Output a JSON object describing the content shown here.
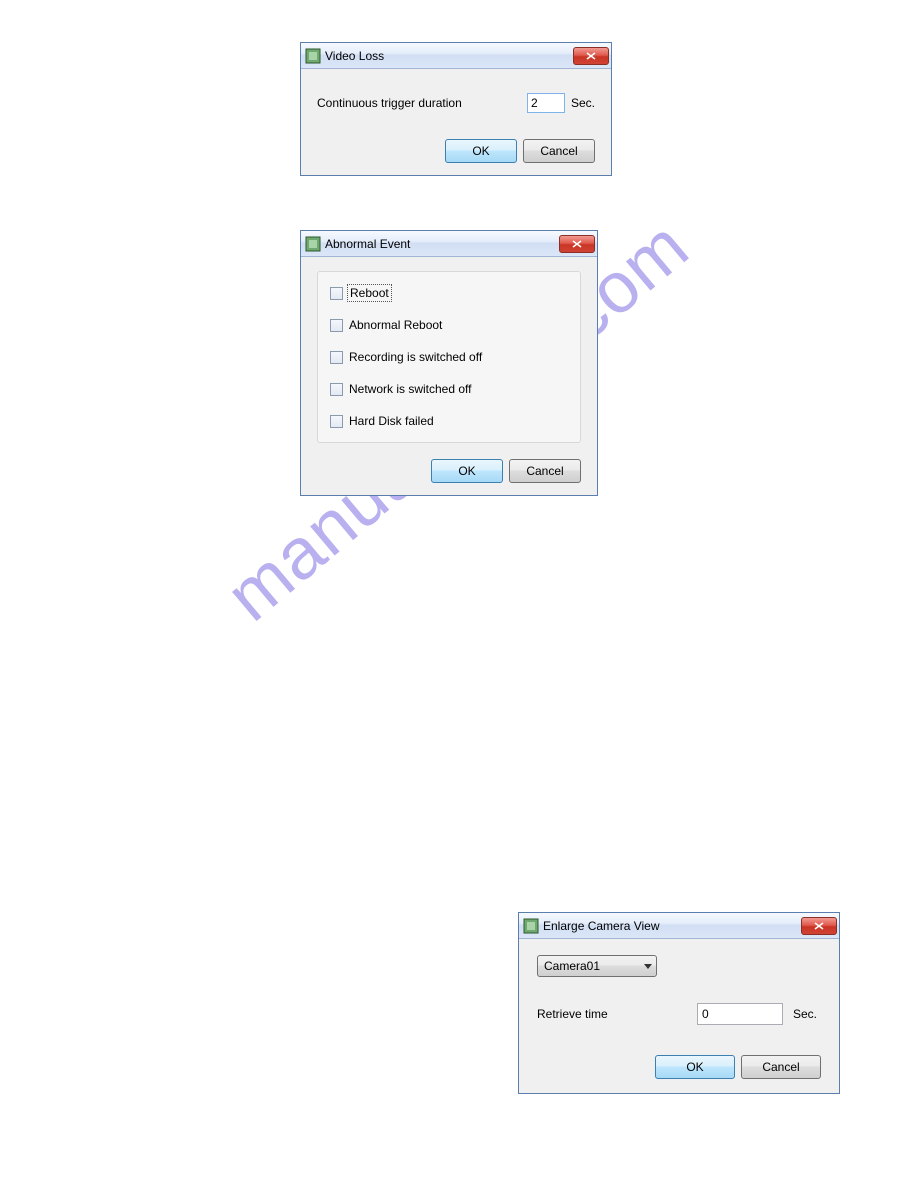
{
  "watermark": "manualshive.com",
  "video_loss": {
    "title": "Video Loss",
    "label": "Continuous trigger duration",
    "value": "2",
    "unit": "Sec.",
    "ok": "OK",
    "cancel": "Cancel"
  },
  "abnormal": {
    "title": "Abnormal Event",
    "items": [
      "Reboot",
      "Abnormal Reboot",
      "Recording is switched off",
      "Network is switched off",
      "Hard Disk failed"
    ],
    "ok": "OK",
    "cancel": "Cancel"
  },
  "enlarge": {
    "title": "Enlarge Camera View",
    "camera": "Camera01",
    "retrieve_label": "Retrieve time",
    "retrieve_value": "0",
    "unit": "Sec.",
    "ok": "OK",
    "cancel": "Cancel"
  }
}
